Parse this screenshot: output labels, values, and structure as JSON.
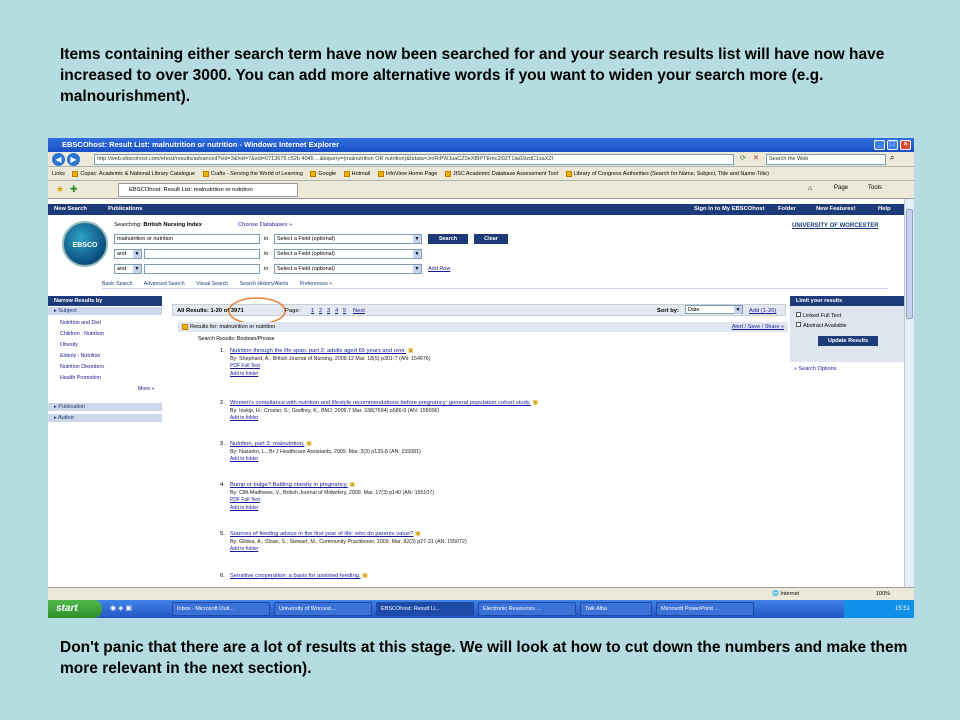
{
  "caption_top": "Items containing either search term have now been searched for and your search results list will have now have increased to over 3000. You can add more alternative words if you want to widen your search more (e.g. malnourishment).",
  "caption_bottom": "Don't panic that there are a lot of results at this stage. We will look at how to cut down the numbers and make them more relevant in the next section).",
  "window": {
    "title": "EBSCOhost: Result List: malnutrition or nutrition - Windows Internet Explorer",
    "address": "http://web.ebscohost.com/ehost/results/advanced?vid=3&hid=7&sid=0713679 c52b 4045 ...&bquery=(malnutrition OR nutrition)&bdata=JmRiPWJuaCZ0eXBlPTEmc2l0ZT1laG9zdC1saXZl",
    "search_placeholder": "Search the Web",
    "tab_label": "EBSCOhost: Result List: malnutrition or nutrition",
    "page_label": "Page",
    "tools_label": "Tools"
  },
  "links_bar": [
    "Links",
    "Copac: Academic & National Library Catalogue",
    "Crafts - Serving the World of Learning",
    "Google",
    "Hotmail",
    "InfoView Home Page",
    "JISC Academic Database Assessment Tool",
    "Library of Congress Authorities (Search for Name, Subject, Title and Name-Title)"
  ],
  "ebsco_nav": {
    "new_search": "New Search",
    "publications": "Publications",
    "sign_in": "Sign In to My EBSCOhost",
    "folder": "Folder",
    "new_features": "New Features!",
    "help": "Help",
    "institution": "UNIVERSITY OF WORCESTER"
  },
  "logo_text": "EBSCO",
  "search": {
    "searching_label": "Searching:",
    "database": "British Nursing Index",
    "choose_db": "Choose Databases »",
    "rows": [
      {
        "bool": "",
        "term": "malnutrition or nutrition",
        "in": "in",
        "field": "Select a Field (optional)"
      },
      {
        "bool": "and",
        "term": "",
        "in": "in",
        "field": "Select a Field (optional)"
      },
      {
        "bool": "and",
        "term": "",
        "in": "in",
        "field": "Select a Field (optional)"
      }
    ],
    "search_btn": "Search",
    "clear_btn": "Clear",
    "add_row": "Add Row",
    "subnav": [
      "Basic Search",
      "Advanced Search",
      "Visual Search",
      "Search History/Alerts",
      "Preferences »"
    ]
  },
  "left_panel": {
    "heading": "Narrow Results by",
    "subject_label": "Subject",
    "subjects": [
      "Nutrition and Diet",
      "Children : Nutrition",
      "Obesity",
      "Elderly : Nutrition",
      "Nutrition Disorders",
      "Health Promotion"
    ],
    "more": "More »",
    "publication": "Publication",
    "author": "Author"
  },
  "results_bar": {
    "count": "All Results: 1-20 of 3971",
    "page_label": "Page:",
    "pages": [
      "1",
      "2",
      "3",
      "4",
      "5"
    ],
    "next": "Next",
    "sort_label": "Sort by:",
    "sort_value": "Date",
    "add": "Add (1-20)"
  },
  "results_for": "Results for: malnutrition or nutrition",
  "alert_link": "Alert / Save / Share »",
  "search_modes": "Search Results: Boolean/Phrase",
  "results": [
    {
      "num": "1.",
      "title": "Nutrition through the life span. part 3: adults aged 65 years and over.",
      "byline": "By: Shephard, A., British Journal of Nursing, 2009.12 Mar. 18(5) p301-7 (AN: 154976)",
      "pdf": "PDF Full Text",
      "folder": "Add to folder"
    },
    {
      "num": "2.",
      "title": "Women's compliance with nutrition and lifestyle recommendations before pregnancy: general population cohort study.",
      "byline": "By: Inskip, H.; Crozier, S.; Godfrey, K., BMJ, 2009.7 Mar. 338(7694) p586-9 (AN: 155006)",
      "pdf": "",
      "folder": "Add to folder"
    },
    {
      "num": "3.",
      "title": "Nutrition, part 3: malnutrition.",
      "byline": "By: Nazarko, L., Br J Healthcare Assistants, 2009. Mar. 3(3) p133-8 (AN: 155081)",
      "pdf": "",
      "folder": "Add to folder"
    },
    {
      "num": "4.",
      "title": "Bump or bulge? Battling obesity in pregnancy.",
      "byline": "By: Clift-Matthews, V., British Journal of Midwifery, 2009. Mar. 17(3) p140 (AN: 155107)",
      "pdf": "PDF Full Text",
      "folder": "Add to folder"
    },
    {
      "num": "5.",
      "title": "Sources of feeding advice in the first year of life: who do parents value?",
      "byline": "By: Gildea, A.; Sloan, S.; Stewart, M., Community Practitioner, 2009. Mar. 82(3) p27-31 (AN: 155072)",
      "pdf": "",
      "folder": "Add to folder"
    },
    {
      "num": "6.",
      "title": "Sensitive cooperation: a basis for assisted feeding.",
      "byline": "",
      "pdf": "",
      "folder": ""
    }
  ],
  "right_panel": {
    "heading": "Limit your results",
    "options": [
      "Linked Full Text",
      "Abstract Available"
    ],
    "update_btn": "Update Results",
    "search_options": "» Search Options"
  },
  "status": {
    "internet": "Internet",
    "zoom": "100%"
  },
  "taskbar": {
    "start": "start",
    "tasks": [
      "Inbox - Microsoft Outl...",
      "University of Worcest...",
      "EBSCOhost: Result Li...",
      "Electronic Resources ...",
      "Talk Alba",
      "Microsoft PowerPoint ..."
    ],
    "clock": "15:51"
  },
  "colors": {
    "background": "#b5dce0",
    "ebsco_blue": "#1d3b78",
    "annotation_circle": "#e8803a"
  }
}
